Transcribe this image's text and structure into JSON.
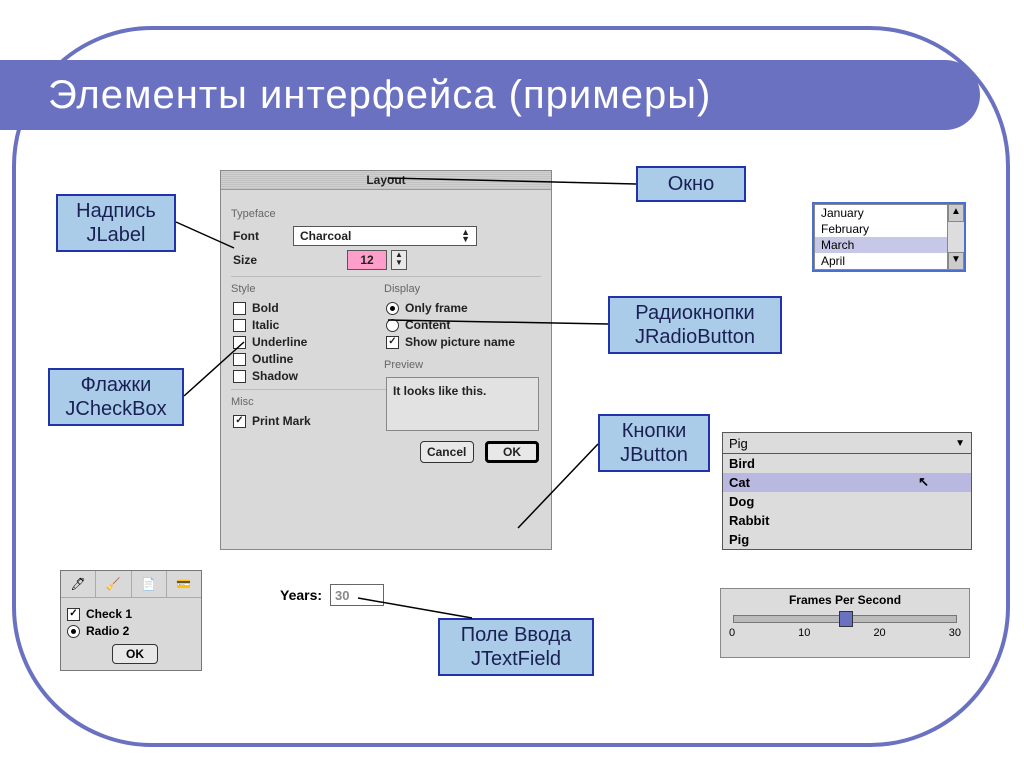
{
  "slide": {
    "title": "Элементы интерфейса (примеры)"
  },
  "callouts": {
    "label": {
      "line1": "Надпись",
      "line2": "JLabel"
    },
    "checkbox": {
      "line1": "Флажки",
      "line2": "JCheckBox"
    },
    "window": {
      "line1": "Окно"
    },
    "radio": {
      "line1": "Радиокнопки",
      "line2": "JRadioButton"
    },
    "button": {
      "line1": "Кнопки",
      "line2": "JButton"
    },
    "textfield": {
      "line1": "Поле Ввода",
      "line2": "JTextField"
    }
  },
  "layoutWindow": {
    "title": "Layout",
    "typeface": {
      "group": "Typeface",
      "fontLabel": "Font",
      "fontValue": "Charcoal",
      "sizeLabel": "Size",
      "sizeValue": "12"
    },
    "style": {
      "group": "Style",
      "items": [
        "Bold",
        "Italic",
        "Underline",
        "Outline",
        "Shadow"
      ]
    },
    "display": {
      "group": "Display",
      "onlyFrame": "Only frame",
      "content": "Content",
      "showPic": "Show picture name"
    },
    "misc": {
      "group": "Misc",
      "printMark": "Print Mark"
    },
    "preview": {
      "group": "Preview",
      "text": "It looks like this."
    },
    "buttons": {
      "cancel": "Cancel",
      "ok": "OK"
    }
  },
  "palette": {
    "check": "Check 1",
    "radio": "Radio 2",
    "ok": "OK"
  },
  "years": {
    "label": "Years:",
    "value": "30"
  },
  "months": {
    "items": [
      "January",
      "February",
      "March",
      "April"
    ],
    "selected": "March"
  },
  "animals": {
    "closed": "Pig",
    "items": [
      "Bird",
      "Cat",
      "Dog",
      "Rabbit",
      "Pig"
    ],
    "selected": "Cat"
  },
  "slider": {
    "title": "Frames Per Second",
    "ticks": [
      "0",
      "10",
      "20",
      "30"
    ]
  }
}
